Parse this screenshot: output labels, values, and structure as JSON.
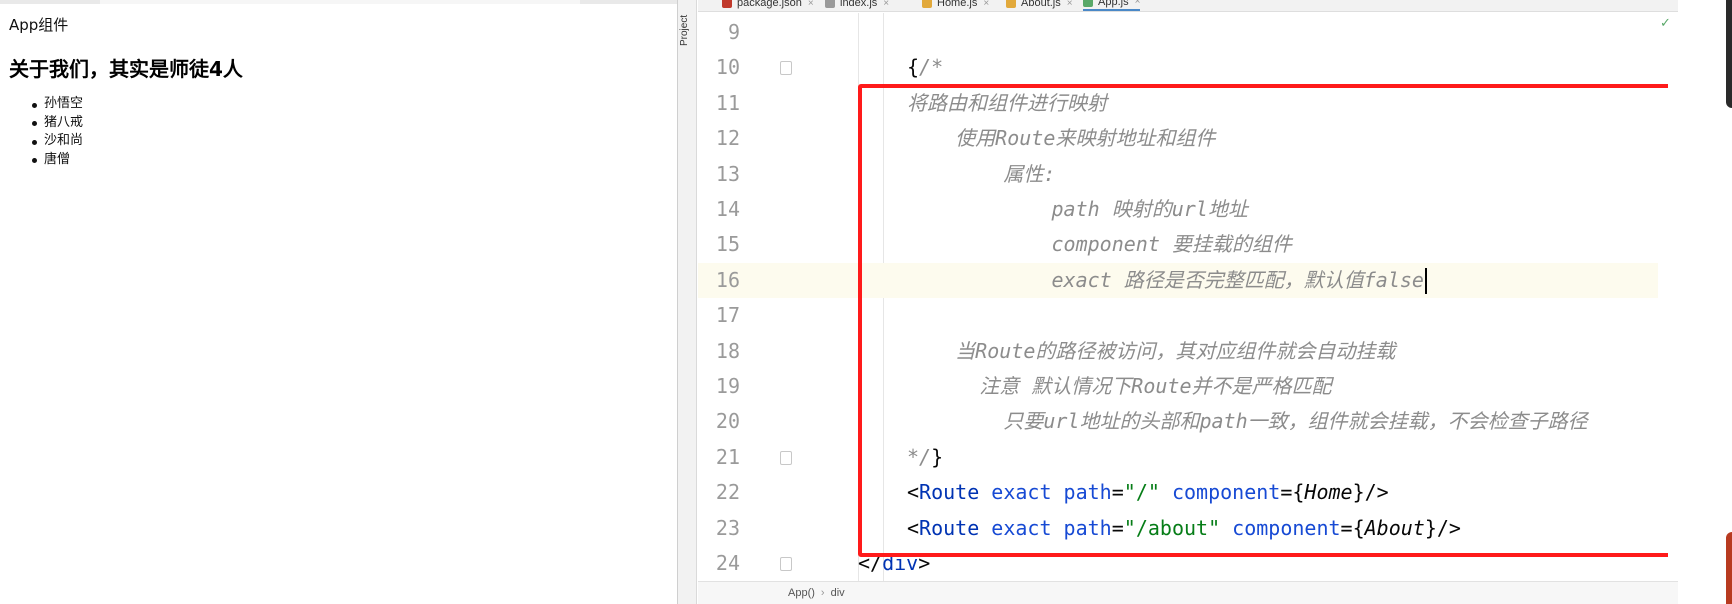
{
  "browser": {
    "app_label": "App组件",
    "heading": "关于我们，其实是师徒4人",
    "members": [
      "孙悟空",
      "猪八戒",
      "沙和尚",
      "唐僧"
    ]
  },
  "ide": {
    "project_tab": "Project",
    "tabs": [
      {
        "label": "package.json",
        "icon_color": "#c0392b",
        "active": false
      },
      {
        "label": "index.js",
        "icon_color": "#9a9a9a",
        "active": false
      },
      {
        "label": "Home.js",
        "icon_color": "#e2a93b",
        "active": false
      },
      {
        "label": "About.js",
        "icon_color": "#e2a93b",
        "active": false
      },
      {
        "label": "App.js",
        "icon_color": "#59a869",
        "active": true
      }
    ],
    "close_glyph": "×",
    "check_glyph": "✓",
    "code_lines": [
      {
        "number": "9",
        "segments": []
      },
      {
        "number": "10",
        "segments": [
          {
            "t": "{",
            "c": "pl"
          },
          {
            "t": "/*",
            "c": "cm"
          }
        ]
      },
      {
        "number": "11",
        "segments": [
          {
            "t": "将路由和组件进行映射",
            "c": "cm"
          }
        ]
      },
      {
        "number": "12",
        "segments": [
          {
            "t": "    使用Route来映射地址和组件",
            "c": "cm"
          }
        ]
      },
      {
        "number": "13",
        "segments": [
          {
            "t": "        属性:",
            "c": "cm"
          }
        ]
      },
      {
        "number": "14",
        "segments": [
          {
            "t": "            path 映射的url地址",
            "c": "cm"
          }
        ]
      },
      {
        "number": "15",
        "segments": [
          {
            "t": "            component 要挂载的组件",
            "c": "cm"
          }
        ]
      },
      {
        "number": "16",
        "segments": [
          {
            "t": "            exact 路径是否完整匹配，默认值false",
            "c": "cm"
          }
        ]
      },
      {
        "number": "17",
        "segments": []
      },
      {
        "number": "18",
        "segments": [
          {
            "t": "    当Route的路径被访问，其对应组件就会自动挂载",
            "c": "cm"
          }
        ]
      },
      {
        "number": "19",
        "segments": [
          {
            "t": "      注意 默认情况下Route并不是严格匹配",
            "c": "cm"
          }
        ]
      },
      {
        "number": "20",
        "segments": [
          {
            "t": "        只要url地址的头部和path一致，组件就会挂载，不会检查子路径",
            "c": "cm"
          }
        ]
      },
      {
        "number": "21",
        "segments": [
          {
            "t": "*/",
            "c": "cm"
          },
          {
            "t": "}",
            "c": "pl"
          }
        ]
      },
      {
        "number": "22",
        "segments": [
          {
            "t": "<",
            "c": "pl"
          },
          {
            "t": "Route",
            "c": "tg"
          },
          {
            "t": " exact",
            "c": "at"
          },
          {
            "t": " path",
            "c": "at"
          },
          {
            "t": "=",
            "c": "pl"
          },
          {
            "t": "\"/\"",
            "c": "st"
          },
          {
            "t": " component",
            "c": "at"
          },
          {
            "t": "={",
            "c": "pl"
          },
          {
            "t": "Home",
            "c": "it"
          },
          {
            "t": "}/>",
            "c": "pl"
          }
        ]
      },
      {
        "number": "23",
        "segments": [
          {
            "t": "<",
            "c": "pl"
          },
          {
            "t": "Route",
            "c": "tg"
          },
          {
            "t": " exact",
            "c": "at"
          },
          {
            "t": " path",
            "c": "at"
          },
          {
            "t": "=",
            "c": "pl"
          },
          {
            "t": "\"/about\"",
            "c": "st"
          },
          {
            "t": " component",
            "c": "at"
          },
          {
            "t": "={",
            "c": "pl"
          },
          {
            "t": "About",
            "c": "it"
          },
          {
            "t": "}/>",
            "c": "pl"
          }
        ]
      },
      {
        "number": "24",
        "segments": [
          {
            "t": "</",
            "c": "pl"
          },
          {
            "t": "div",
            "c": "tg"
          },
          {
            "t": ">",
            "c": "pl"
          }
        ]
      }
    ],
    "current_line": "16",
    "breadcrumb": [
      "App()",
      "div"
    ],
    "breadcrumb_separator": "›",
    "highlight_color": "#ff1a1a"
  }
}
